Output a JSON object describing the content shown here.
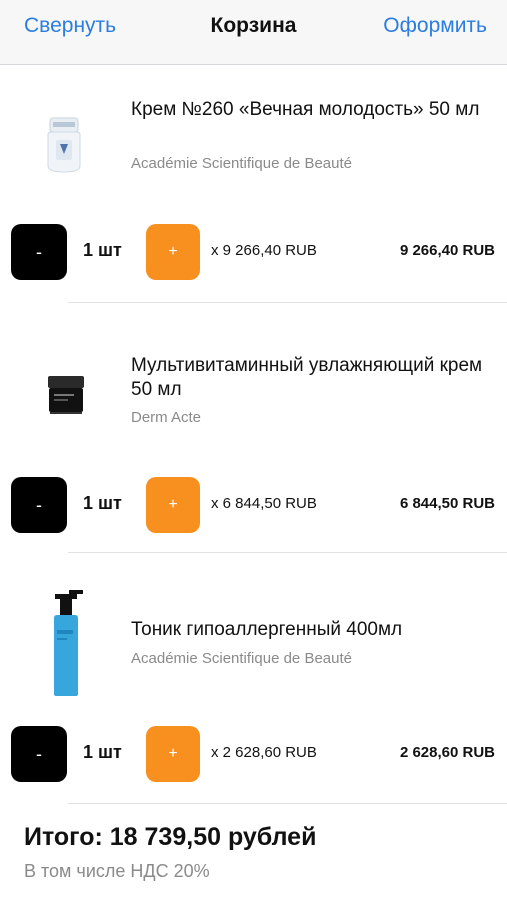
{
  "navbar": {
    "collapse_label": "Свернуть",
    "title": "Корзина",
    "checkout_label": "Оформить"
  },
  "cart": {
    "items": [
      {
        "name": "Крем №260 «Вечная молодость» 50 мл",
        "brand": "Académie Scientifique de Beauté",
        "minus_label": "-",
        "qty": "1 шт",
        "plus_label": "+",
        "unit_price": "x  9 266,40 RUB",
        "total": "9 266,40 RUB",
        "thumb_icon": "cream-jar-icon"
      },
      {
        "name": "Мультивитаминный увлажняющий крем 50 мл",
        "brand": "Derm Acte",
        "minus_label": "-",
        "qty": "1 шт",
        "plus_label": "+",
        "unit_price": "x  6 844,50 RUB",
        "total": "6 844,50 RUB",
        "thumb_icon": "dark-jar-icon"
      },
      {
        "name": "Тоник гипоаллергенный 400мл",
        "brand": "Académie Scientifique de Beauté",
        "minus_label": "-",
        "qty": "1 шт",
        "plus_label": "+",
        "unit_price": "x  2 628,60 RUB",
        "total": "2 628,60 RUB",
        "thumb_icon": "pump-bottle-icon"
      }
    ]
  },
  "summary": {
    "total": "Итого: 18 739,50 рублей",
    "vat": "В том числе НДС 20%"
  },
  "colors": {
    "link": "#2b7de0",
    "plus_button": "#f7901e",
    "minus_button": "#000000",
    "secondary_text": "#8a8a8a"
  }
}
